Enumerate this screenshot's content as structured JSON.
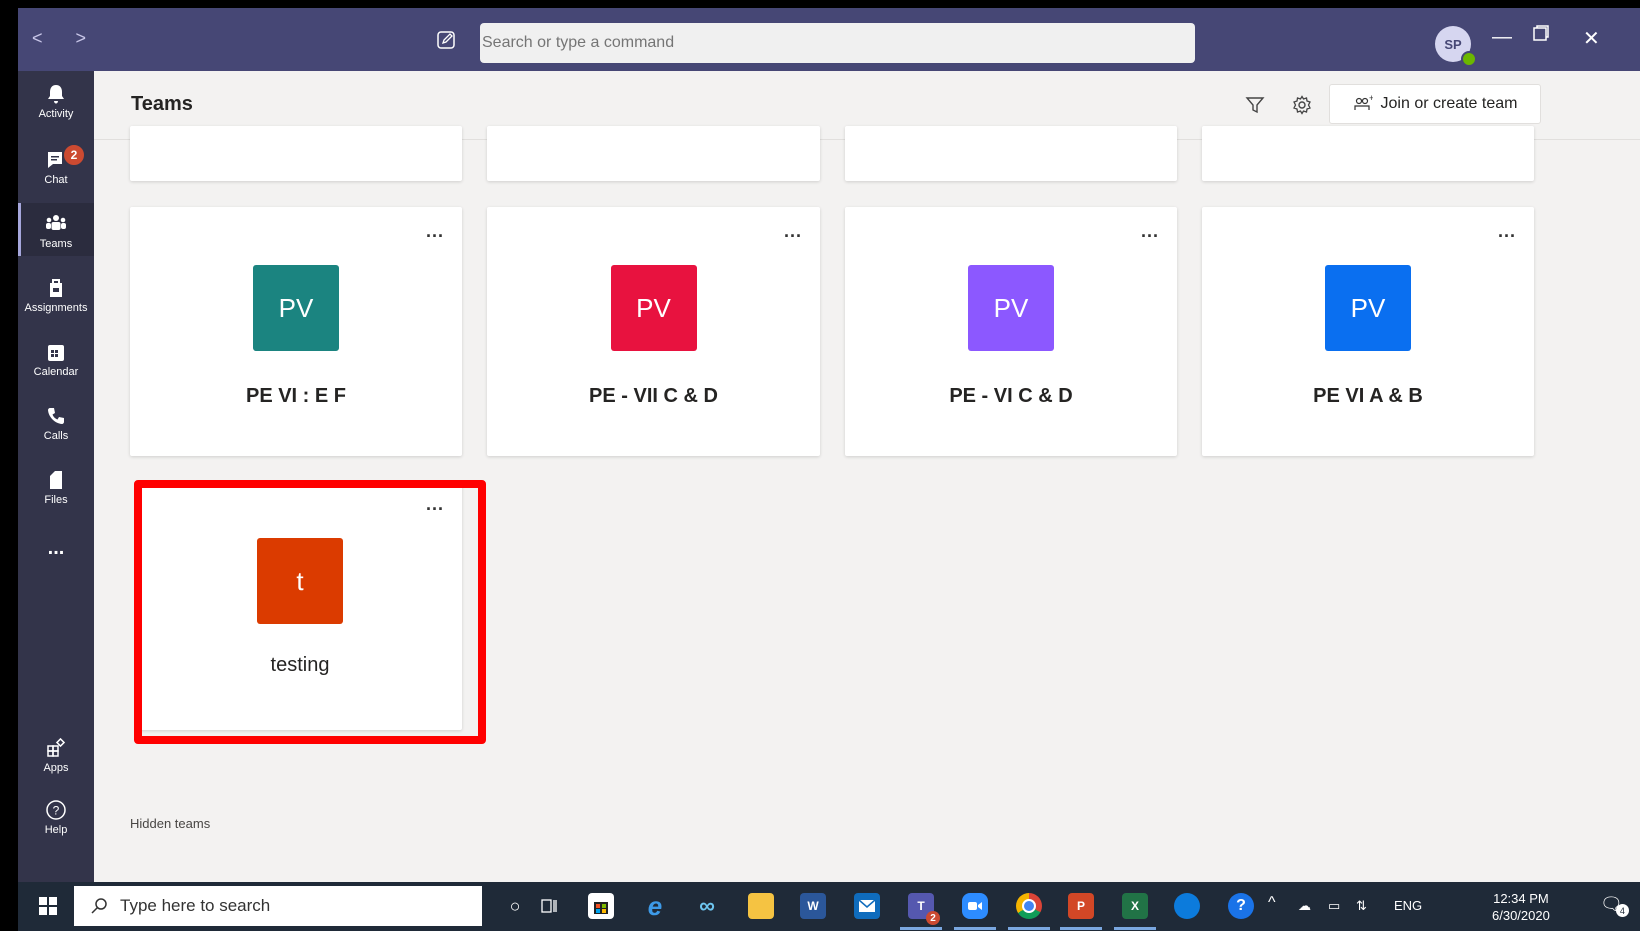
{
  "titlebar": {
    "search_placeholder": "Search or type a command",
    "avatar_initials": "SP"
  },
  "rail": {
    "items": [
      {
        "label": "Activity",
        "icon": "bell-icon"
      },
      {
        "label": "Chat",
        "icon": "chat-icon",
        "badge": "2"
      },
      {
        "label": "Teams",
        "icon": "teams-icon",
        "active": true
      },
      {
        "label": "Assignments",
        "icon": "assignments-icon"
      },
      {
        "label": "Calendar",
        "icon": "calendar-icon"
      },
      {
        "label": "Calls",
        "icon": "phone-icon"
      },
      {
        "label": "Files",
        "icon": "file-icon"
      },
      {
        "label": "Apps",
        "icon": "apps-icon"
      },
      {
        "label": "Help",
        "icon": "help-icon"
      }
    ],
    "more_label": "..."
  },
  "header": {
    "title": "Teams",
    "join_label": "Join or create team"
  },
  "teams": [
    {
      "initials": "PV",
      "name": "PE VI : E F",
      "color": "#1b8480"
    },
    {
      "initials": "PV",
      "name": "PE - VII C & D",
      "color": "#e8123f"
    },
    {
      "initials": "PV",
      "name": "PE - VI C & D",
      "color": "#8c58ff"
    },
    {
      "initials": "PV",
      "name": "PE VI A & B",
      "color": "#0a6ff0"
    },
    {
      "initials": "t",
      "name": "testing",
      "color": "#db3b00"
    }
  ],
  "more_options": "...",
  "hidden_teams_label": "Hidden teams",
  "taskbar": {
    "search_placeholder": "Type here to search",
    "lang": "ENG",
    "time": "12:34 PM",
    "date": "6/30/2020",
    "teams_badge": "2",
    "notif_badge": "4"
  }
}
